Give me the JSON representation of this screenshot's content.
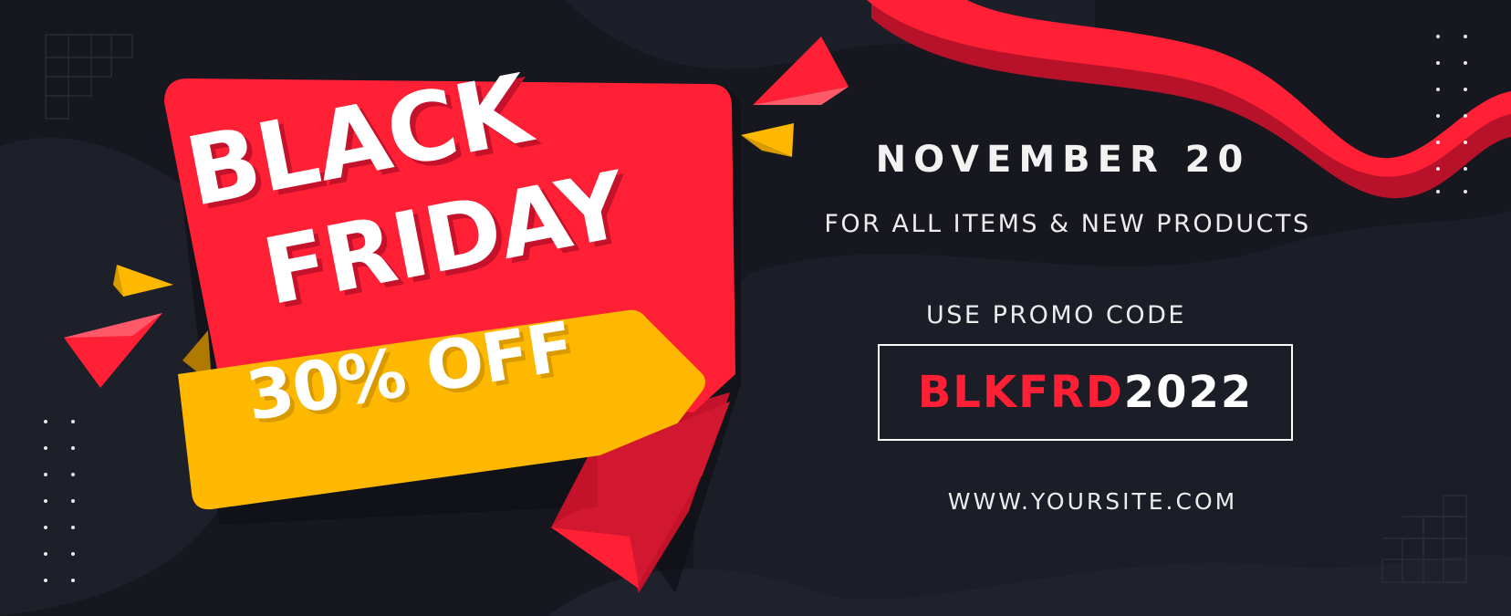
{
  "headline": {
    "line1": "BLACK",
    "line2": "FRIDAY",
    "discount": "30% OFF"
  },
  "event": {
    "date": "NOVEMBER 20",
    "subtitle": "FOR ALL ITEMS & NEW PRODUCTS"
  },
  "promo": {
    "label": "USE PROMO CODE",
    "code_part1": "BLKFRD",
    "code_part2": "2022"
  },
  "website": "WWW.YOURSITE.COM",
  "colors": {
    "background": "#16171f",
    "red": "#ff2035",
    "yellow": "#ffb800",
    "white": "#ffffff"
  }
}
